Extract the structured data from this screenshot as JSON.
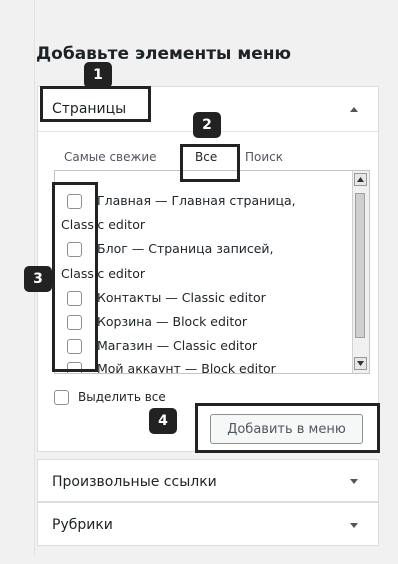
{
  "title": "Добавьте элементы меню",
  "pages_box": {
    "title": "Страницы",
    "tabs": [
      {
        "label": "Самые свежие"
      },
      {
        "label": "Все"
      },
      {
        "label": "Поиск"
      }
    ],
    "items": [
      {
        "label": "Главная — Главная страница,",
        "continuation": "Classic editor"
      },
      {
        "label": "Блог — Страница записей,",
        "continuation": "Classic editor"
      },
      {
        "label": "Контакты — Classic editor"
      },
      {
        "label": "Корзина — Block editor"
      },
      {
        "label": "Магазин — Classic editor"
      },
      {
        "label": "Мой аккаунт — Block editor"
      }
    ],
    "select_all_label": "Выделить все",
    "add_button_label": "Добавить в меню"
  },
  "sections": [
    {
      "title": "Произвольные ссылки"
    },
    {
      "title": "Рубрики"
    }
  ],
  "markers": [
    "1",
    "2",
    "3",
    "4"
  ]
}
